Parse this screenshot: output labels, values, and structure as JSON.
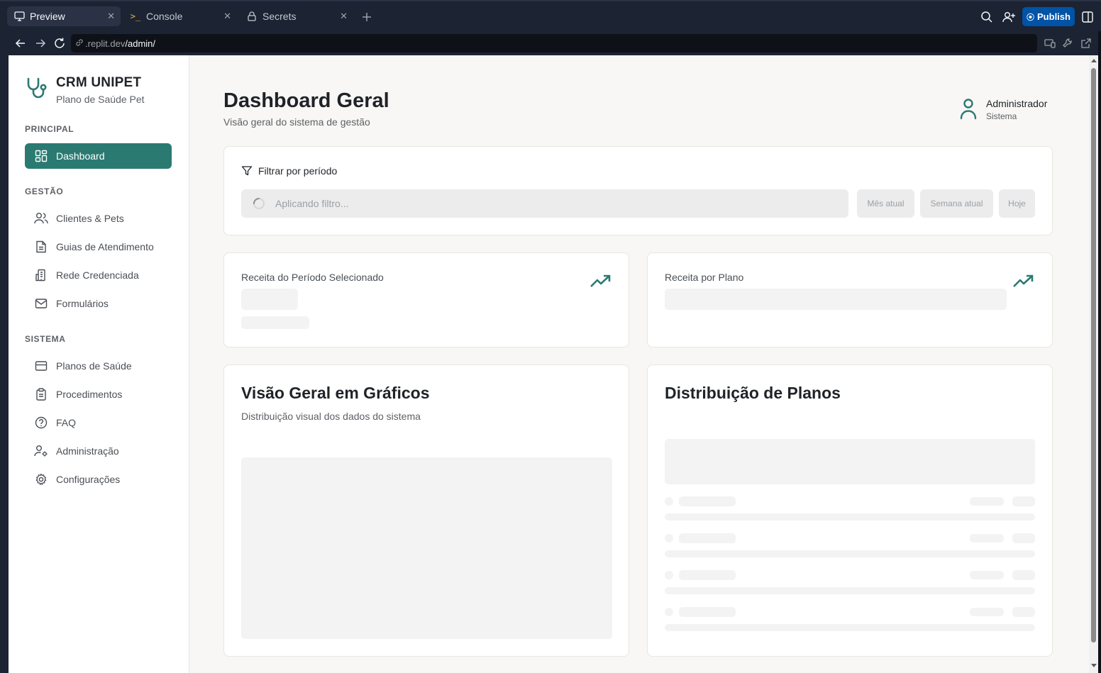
{
  "browser": {
    "tabs": [
      {
        "label": "Preview",
        "icon": "monitor-icon"
      },
      {
        "label": "Console",
        "icon": "terminal-icon"
      },
      {
        "label": "Secrets",
        "icon": "lock-icon"
      }
    ],
    "publish_label": "Publish",
    "url_host": ".replit.dev",
    "url_path": "/admin/"
  },
  "brand": {
    "title": "CRM UNIPET",
    "subtitle": "Plano de Saúde Pet",
    "icon": "stethoscope-icon"
  },
  "sidebar": {
    "sections": [
      {
        "label": "PRINCIPAL",
        "items": [
          {
            "label": "Dashboard",
            "icon": "dashboard-icon"
          }
        ]
      },
      {
        "label": "GESTÃO",
        "items": [
          {
            "label": "Clientes & Pets",
            "icon": "users-icon"
          },
          {
            "label": "Guias de Atendimento",
            "icon": "document-icon"
          },
          {
            "label": "Rede Credenciada",
            "icon": "building-icon"
          },
          {
            "label": "Formulários",
            "icon": "mail-icon"
          }
        ]
      },
      {
        "label": "SISTEMA",
        "items": [
          {
            "label": "Planos de Saúde",
            "icon": "credit-card-icon"
          },
          {
            "label": "Procedimentos",
            "icon": "clipboard-icon"
          },
          {
            "label": "FAQ",
            "icon": "help-icon"
          },
          {
            "label": "Administração",
            "icon": "user-cog-icon"
          },
          {
            "label": "Configurações",
            "icon": "gear-icon"
          }
        ]
      }
    ]
  },
  "header": {
    "title": "Dashboard Geral",
    "subtitle": "Visão geral do sistema de gestão",
    "user_name": "Administrador",
    "user_role": "Sistema"
  },
  "filter": {
    "title": "Filtrar por período",
    "placeholder": "Aplicando filtro...",
    "presets": [
      "Mês atual",
      "Semana atual",
      "Hoje"
    ]
  },
  "kpis": {
    "period_revenue_label": "Receita do Período Selecionado",
    "plan_revenue_label": "Receita por Plano"
  },
  "charts_card": {
    "title": "Visão Geral em Gráficos",
    "subtitle": "Distribuição visual dos dados do sistema"
  },
  "plans_card": {
    "title": "Distribuição de Planos"
  },
  "colors": {
    "accent": "#2a7a72",
    "publish": "#0053a6",
    "chrome": "#1c2333"
  }
}
